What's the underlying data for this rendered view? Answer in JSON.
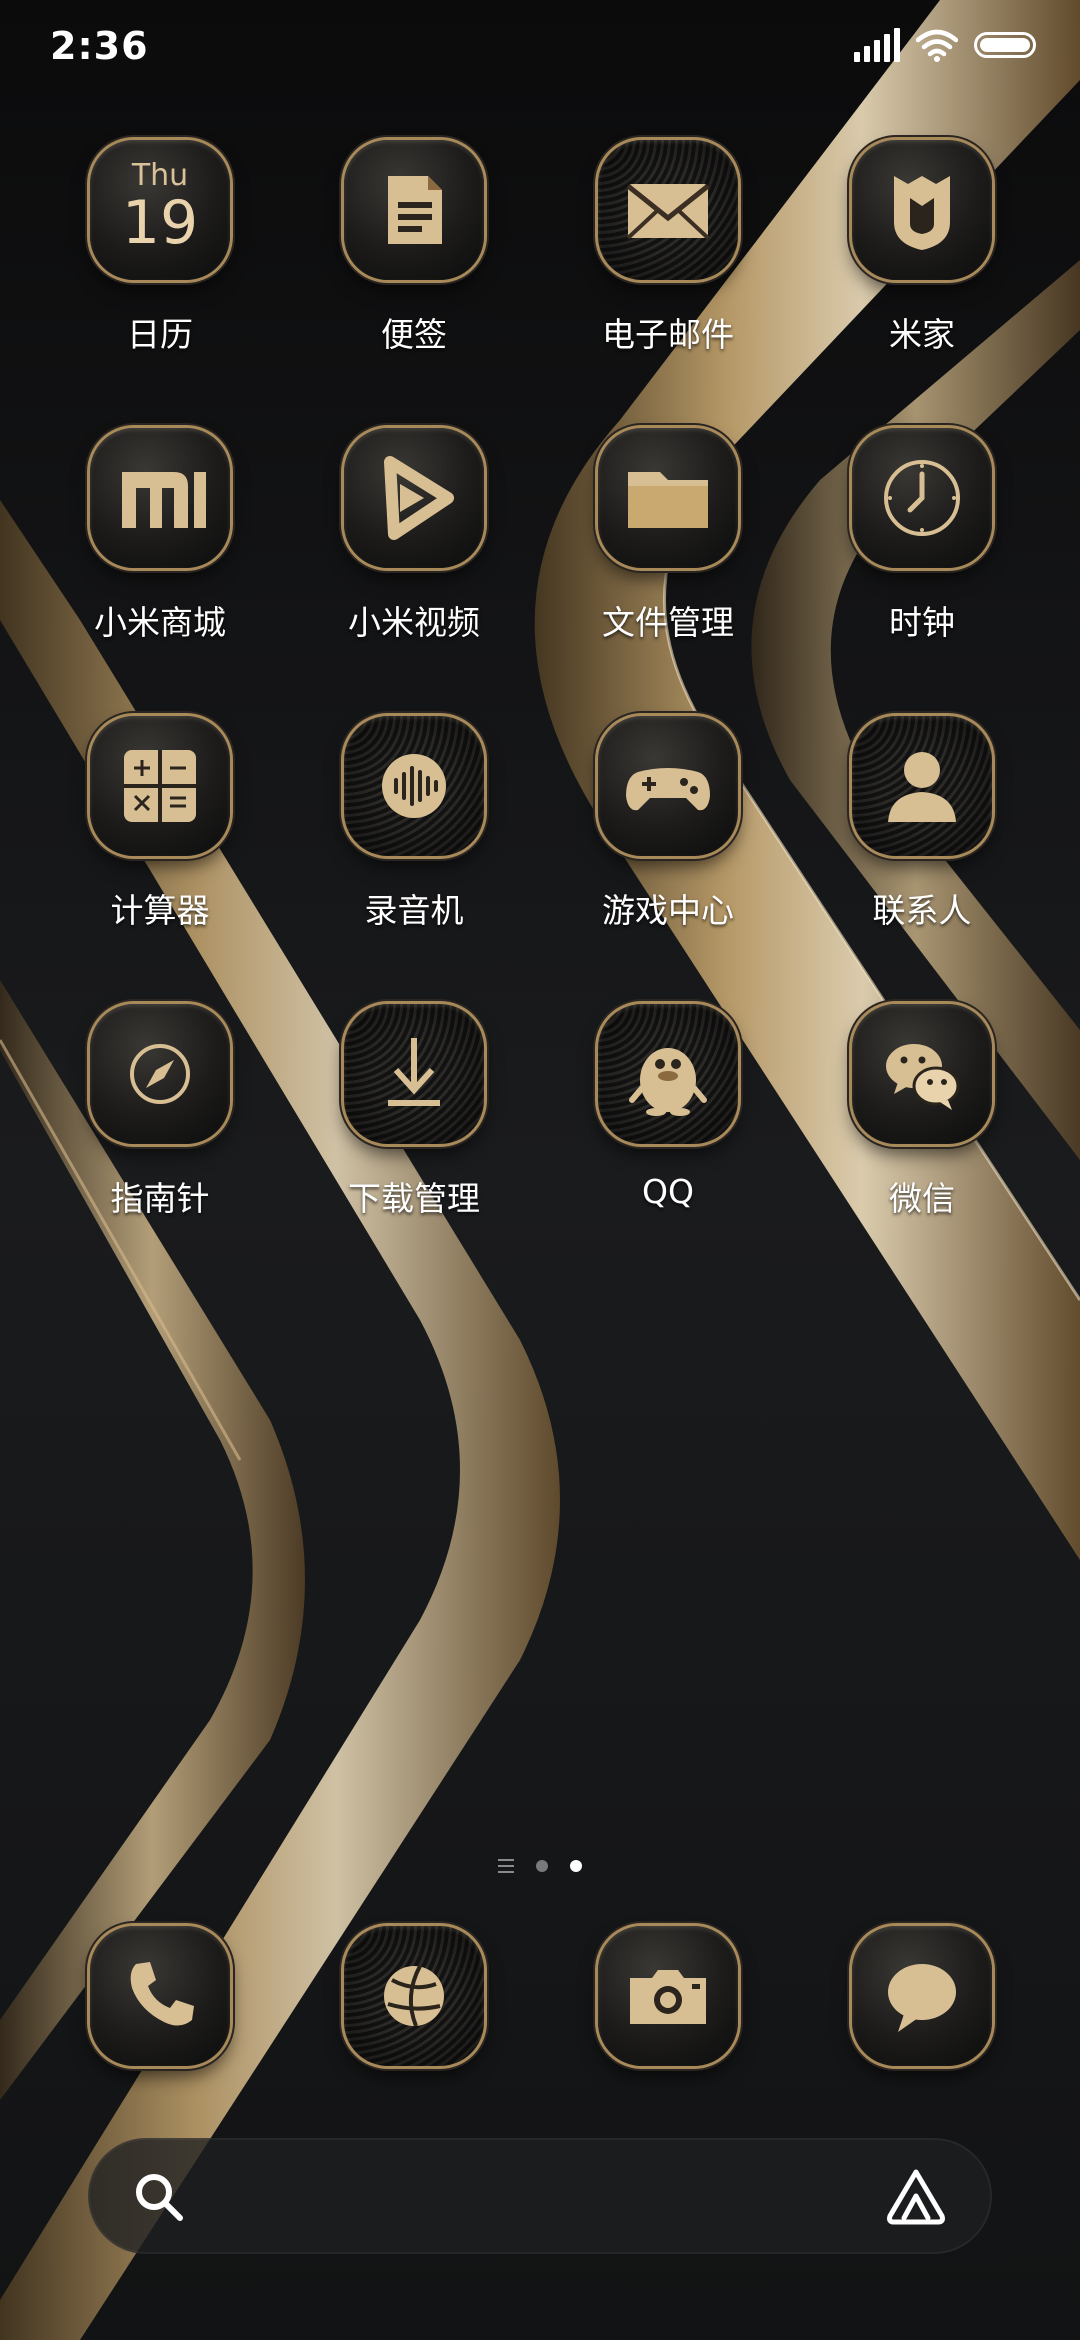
{
  "status_bar": {
    "time": "2:36"
  },
  "calendar_icon": {
    "weekday": "Thu",
    "date": "19"
  },
  "apps": [
    {
      "label": "日历",
      "icon": "calendar-icon"
    },
    {
      "label": "便签",
      "icon": "notes-icon"
    },
    {
      "label": "电子邮件",
      "icon": "email-icon"
    },
    {
      "label": "米家",
      "icon": "mijia-icon"
    },
    {
      "label": "小米商城",
      "icon": "mi-store-icon"
    },
    {
      "label": "小米视频",
      "icon": "video-icon"
    },
    {
      "label": "文件管理",
      "icon": "folder-icon"
    },
    {
      "label": "时钟",
      "icon": "clock-icon"
    },
    {
      "label": "计算器",
      "icon": "calculator-icon"
    },
    {
      "label": "录音机",
      "icon": "recorder-icon"
    },
    {
      "label": "游戏中心",
      "icon": "gamepad-icon"
    },
    {
      "label": "联系人",
      "icon": "contacts-icon"
    },
    {
      "label": "指南针",
      "icon": "compass-icon"
    },
    {
      "label": "下载管理",
      "icon": "download-icon"
    },
    {
      "label": "QQ",
      "icon": "qq-penguin-icon"
    },
    {
      "label": "微信",
      "icon": "wechat-icon"
    }
  ],
  "dock": [
    {
      "icon": "phone-icon"
    },
    {
      "icon": "browser-icon"
    },
    {
      "icon": "camera-icon"
    },
    {
      "icon": "messages-icon"
    }
  ],
  "page_indicator": {
    "pages": 2,
    "current": 2
  },
  "colors": {
    "gold": "#d8bf93",
    "gold_dark": "#8a6a3e",
    "background": "#141516"
  }
}
